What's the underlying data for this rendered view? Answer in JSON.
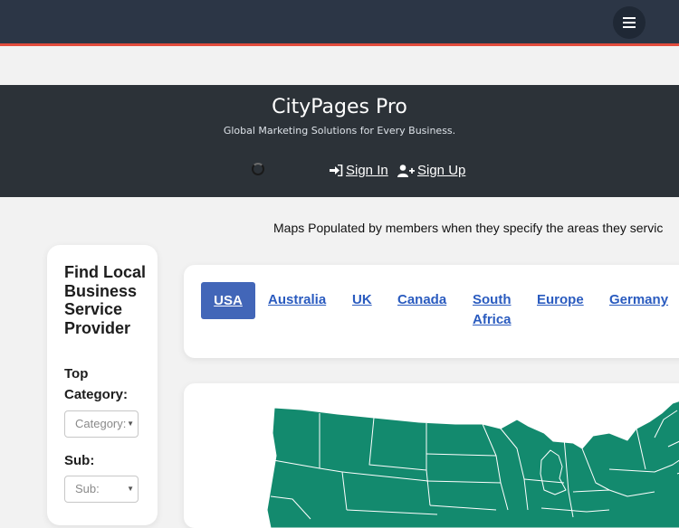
{
  "navbar": {
    "menu_icon": "hamburger-icon",
    "accent_color": "#e24c3d",
    "background": "#2c3646"
  },
  "hero": {
    "brand": "CityPages Pro",
    "tagline": "Global Marketing Solutions for Every Business.",
    "sign_in": " Sign In",
    "sign_up": " Sign Up",
    "sign_in_icon": "sign-in-icon",
    "sign_up_icon": "user-plus-icon"
  },
  "intro_text": "Maps Populated by members when they specify the areas they servic",
  "sidebar": {
    "title": "Find Local Business Service Provider",
    "top_category_label": "Top Category:",
    "category_placeholder": "Category:",
    "sub_label": "Sub:",
    "sub_placeholder": "Sub:"
  },
  "tabs": [
    {
      "label": "USA",
      "active": true
    },
    {
      "label": "Australia"
    },
    {
      "label": "UK"
    },
    {
      "label": "Canada"
    },
    {
      "label": "South Africa"
    },
    {
      "label": "Europe"
    },
    {
      "label": "Germany"
    }
  ],
  "map": {
    "fill_color": "#138a6e",
    "border_color": "#ffffff"
  }
}
